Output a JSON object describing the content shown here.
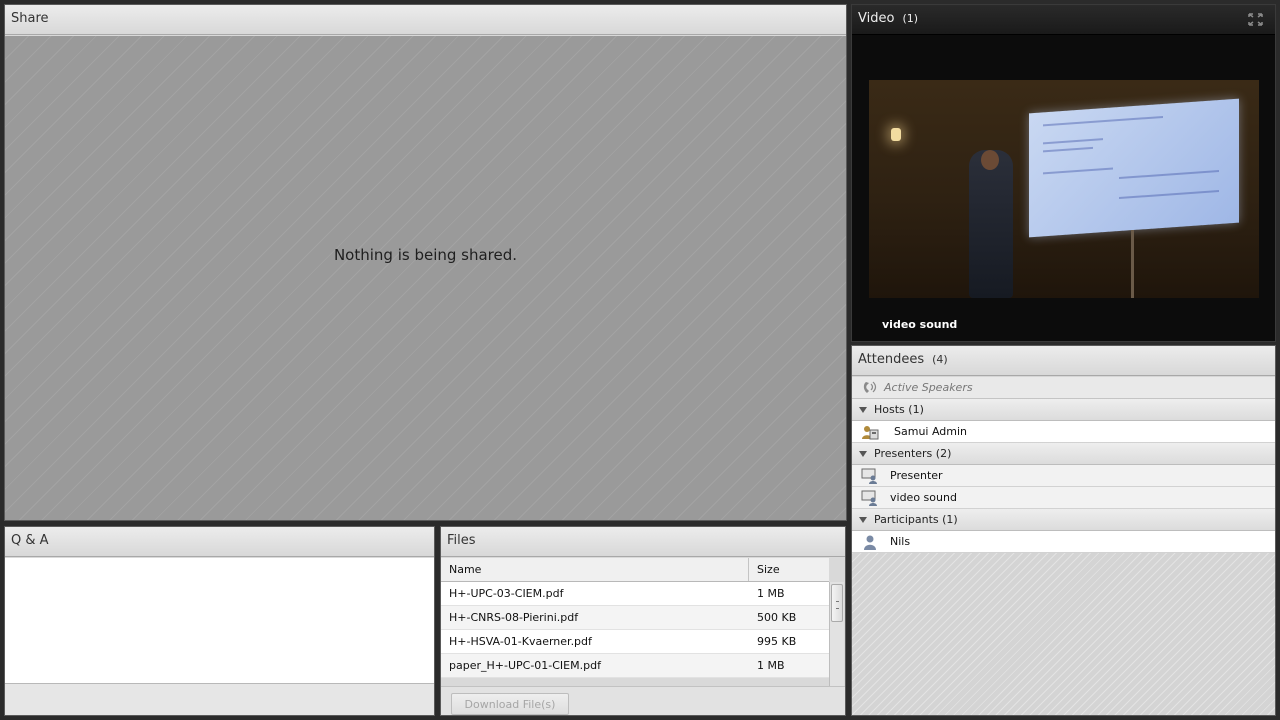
{
  "share": {
    "title": "Share",
    "message": "Nothing is being shared."
  },
  "video": {
    "title": "Video",
    "count": "(1)",
    "feed_name": "video sound",
    "fullscreen_icon": "expand-icon"
  },
  "attendees": {
    "title": "Attendees",
    "count": "(4)",
    "active_speakers": "Active Speakers",
    "groups": [
      {
        "label": "Hosts (1)",
        "members": [
          {
            "name": "Samui Admin",
            "icon": "host-icon"
          }
        ]
      },
      {
        "label": "Presenters (2)",
        "members": [
          {
            "name": "Presenter",
            "icon": "presenter-icon"
          },
          {
            "name": "video sound",
            "icon": "presenter-icon"
          }
        ]
      },
      {
        "label": "Participants (1)",
        "members": [
          {
            "name": "Nils",
            "icon": "participant-icon"
          }
        ]
      }
    ]
  },
  "qa": {
    "title": "Q & A"
  },
  "files": {
    "title": "Files",
    "columns": {
      "name": "Name",
      "size": "Size"
    },
    "rows": [
      {
        "name": "H+-UPC-03-CIEM.pdf",
        "size": "1 MB"
      },
      {
        "name": "H+-CNRS-08-Pierini.pdf",
        "size": "500 KB"
      },
      {
        "name": "H+-HSVA-01-Kvaerner.pdf",
        "size": "995 KB"
      },
      {
        "name": "paper_H+-UPC-01-CIEM.pdf",
        "size": "1 MB"
      }
    ],
    "download_label": "Download File(s)"
  }
}
